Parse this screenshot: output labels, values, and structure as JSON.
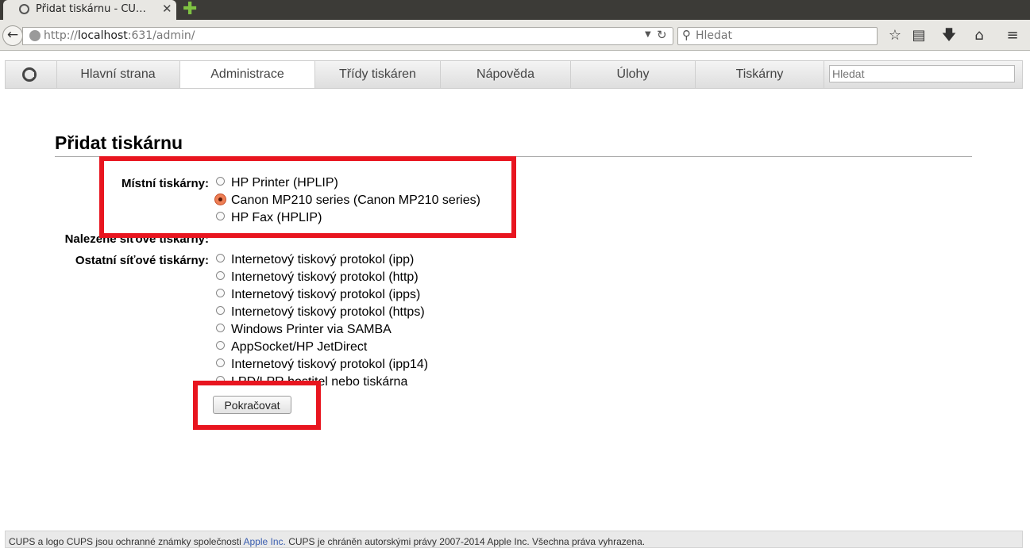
{
  "browser": {
    "tab_title": "Přidat tiskárnu - CU…",
    "tab_close": "✕",
    "new_tab": "✚",
    "url_scheme": "http://",
    "url_host": "localhost",
    "url_rest": ":631/admin/",
    "search_placeholder": "Hledat",
    "icons": [
      "bookmark-star-icon",
      "reading-list-icon",
      "download-icon",
      "home-icon",
      "menu-icon"
    ]
  },
  "cups_nav": {
    "tabs": [
      {
        "label": "Hlavní strana",
        "active": false
      },
      {
        "label": "Administrace",
        "active": true
      },
      {
        "label": "Třídy tiskáren",
        "active": false
      },
      {
        "label": "Nápověda",
        "active": false
      },
      {
        "label": "Úlohy",
        "active": false
      },
      {
        "label": "Tiskárny",
        "active": false
      }
    ],
    "search_placeholder": "Hledat"
  },
  "page": {
    "title": "Přidat tiskárnu",
    "local_label": "Místní tiskárny:",
    "local_printers": [
      {
        "label": "HP Printer (HPLIP)",
        "checked": false
      },
      {
        "label": "Canon MP210 series (Canon MP210 series)",
        "checked": true
      },
      {
        "label": "HP Fax (HPLIP)",
        "checked": false
      }
    ],
    "discovered_label": "Nalezené síťové tiskárny:",
    "other_label": "Ostatní síťové tiskárny:",
    "other_printers": [
      {
        "label": "Internetový tiskový protokol (ipp)",
        "checked": false
      },
      {
        "label": "Internetový tiskový protokol (http)",
        "checked": false
      },
      {
        "label": "Internetový tiskový protokol (ipps)",
        "checked": false
      },
      {
        "label": "Internetový tiskový protokol (https)",
        "checked": false
      },
      {
        "label": "Windows Printer via SAMBA",
        "checked": false
      },
      {
        "label": "AppSocket/HP JetDirect",
        "checked": false
      },
      {
        "label": "Internetový tiskový protokol (ipp14)",
        "checked": false
      },
      {
        "label": "LPD/LPR hostitel nebo tiskárna",
        "checked": false
      }
    ],
    "continue_label": "Pokračovat"
  },
  "annotation_color": "#e8151f",
  "footer": {
    "text_before": "CUPS a logo CUPS jsou ochranné známky společnosti ",
    "link": "Apple Inc.",
    "text_after": " CUPS je chráněn autorskými právy 2007-2014 Apple Inc. Všechna práva vyhrazena."
  }
}
